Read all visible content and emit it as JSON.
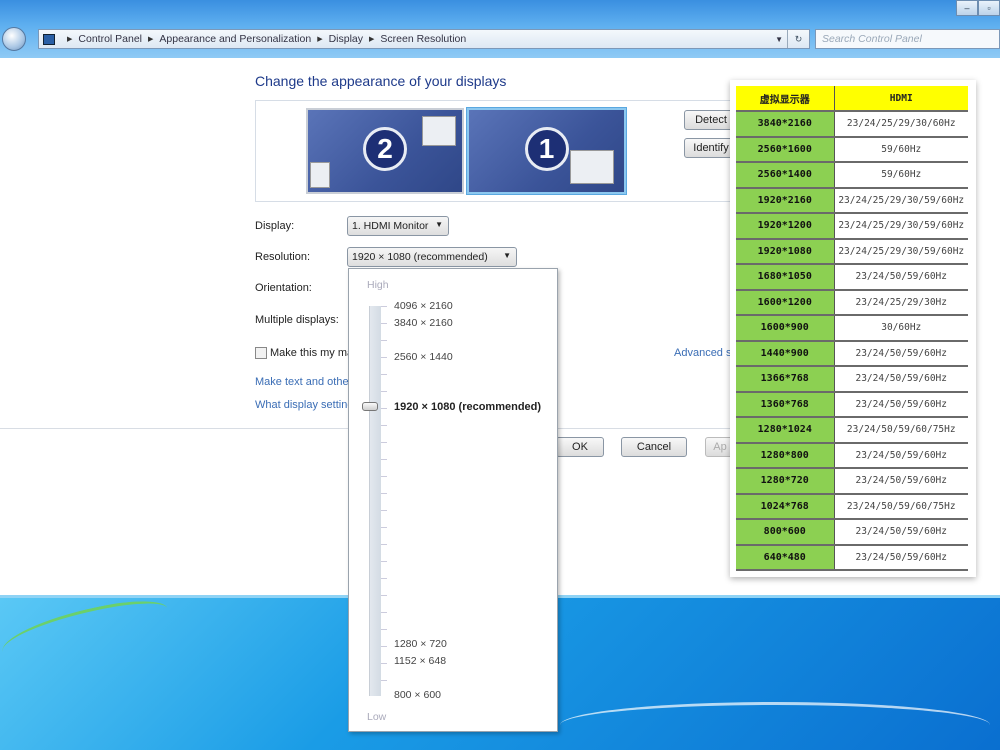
{
  "window": {
    "minimize": "‒",
    "maximize": "▫"
  },
  "address_bar": {
    "crumbs": [
      "Control Panel",
      "Appearance and Personalization",
      "Display",
      "Screen Resolution"
    ],
    "search_placeholder": "Search Control Panel"
  },
  "main": {
    "title": "Change the appearance of your displays",
    "monitors": [
      {
        "number": "2"
      },
      {
        "number": "1"
      }
    ],
    "detect_label": "Detect",
    "identify_label": "Identify",
    "display_label": "Display:",
    "display_value": "1. HDMI Monitor",
    "resolution_label": "Resolution:",
    "resolution_value": "1920 × 1080 (recommended)",
    "orientation_label": "Orientation:",
    "multiple_label": "Multiple displays:",
    "main_display_checkbox": "Make this my ma",
    "advanced_link": "Advanced s",
    "link_text": "Make text and othe",
    "link_settings": "What display setting",
    "ok": "OK",
    "cancel": "Cancel",
    "apply": "Ap"
  },
  "resolution_dropdown": {
    "high": "High",
    "low": "Low",
    "options": [
      "4096 × 2160",
      "3840 × 2160",
      "2560 × 1440",
      "1920 × 1080 (recommended)",
      "1280 × 720",
      "1152 × 648",
      "800 × 600"
    ],
    "selected": "1920 × 1080 (recommended)"
  },
  "spec_table": {
    "headers": [
      "虚拟显示器",
      "HDMI"
    ],
    "rows": [
      [
        "3840*2160",
        "23/24/25/29/30/60Hz"
      ],
      [
        "2560*1600",
        "59/60Hz"
      ],
      [
        "2560*1400",
        "59/60Hz"
      ],
      [
        "1920*2160",
        "23/24/25/29/30/59/60Hz"
      ],
      [
        "1920*1200",
        "23/24/25/29/30/59/60Hz"
      ],
      [
        "1920*1080",
        "23/24/25/29/30/59/60Hz"
      ],
      [
        "1680*1050",
        "23/24/50/59/60Hz"
      ],
      [
        "1600*1200",
        "23/24/25/29/30Hz"
      ],
      [
        "1600*900",
        "30/60Hz"
      ],
      [
        "1440*900",
        "23/24/50/59/60Hz"
      ],
      [
        "1366*768",
        "23/24/50/59/60Hz"
      ],
      [
        "1360*768",
        "23/24/50/59/60Hz"
      ],
      [
        "1280*1024",
        "23/24/50/59/60/75Hz"
      ],
      [
        "1280*800",
        "23/24/50/59/60Hz"
      ],
      [
        "1280*720",
        "23/24/50/59/60Hz"
      ],
      [
        "1024*768",
        "23/24/50/59/60/75Hz"
      ],
      [
        "800*600",
        "23/24/50/59/60Hz"
      ],
      [
        "640*480",
        "23/24/50/59/60Hz"
      ]
    ]
  }
}
